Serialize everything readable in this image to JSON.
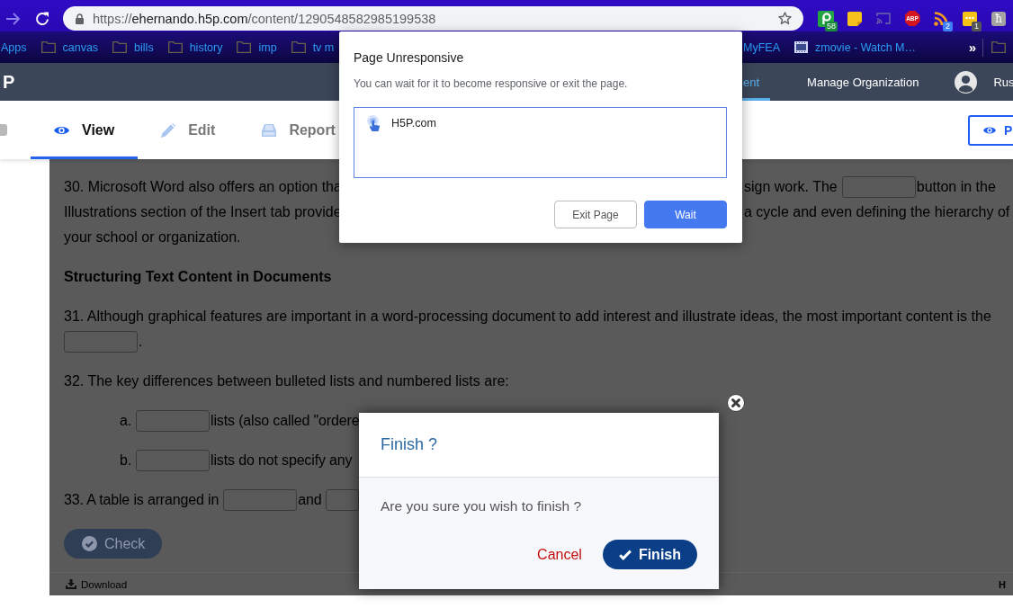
{
  "browser": {
    "nav_buttons": [
      {
        "kind": "forward",
        "disabled": true
      },
      {
        "kind": "reload",
        "disabled": false
      }
    ],
    "address": {
      "scheme": "https://",
      "host": "ehernando.h5p.com",
      "path": "/content/1290548582985199538"
    },
    "extensions": [
      {
        "kind": "pin",
        "badge": "58"
      },
      {
        "kind": "note"
      },
      {
        "kind": "cast"
      },
      {
        "kind": "adblock",
        "label": "ABP"
      },
      {
        "kind": "rss",
        "badge": "2"
      },
      {
        "kind": "chat",
        "badge": "1"
      },
      {
        "kind": "letter",
        "label": "ħ"
      }
    ]
  },
  "bookmarks": {
    "left": [
      {
        "kind": "text",
        "label": "Apps"
      },
      {
        "kind": "folder",
        "label": "canvas"
      },
      {
        "kind": "folder",
        "label": "bills"
      },
      {
        "kind": "folder",
        "label": "history"
      },
      {
        "kind": "folder",
        "label": "imp"
      },
      {
        "kind": "folder",
        "label": "tv m"
      }
    ],
    "right": [
      {
        "kind": "text",
        "label": "MyFEA"
      },
      {
        "kind": "film",
        "label": "zmovie - Watch M…"
      },
      {
        "kind": "more",
        "label": "»"
      },
      {
        "kind": "folder"
      }
    ]
  },
  "nav": {
    "logo": "P",
    "items": [
      {
        "label": "ent",
        "selected": true
      },
      {
        "label": "Manage Organization",
        "selected": false
      }
    ],
    "user": "Rus"
  },
  "tabs": [
    {
      "kind": "view",
      "label": "View",
      "selected": true
    },
    {
      "kind": "edit",
      "label": "Edit",
      "selected": false
    },
    {
      "kind": "report",
      "label": "Report",
      "selected": false
    }
  ],
  "preview_button": {
    "label": "P"
  },
  "content": {
    "blocks": [
      {
        "kind": "paragraph",
        "lines": [
          {
            "kind": "split",
            "parts": [
              {
                "kind": "text",
                "text": "30. Microsoft Word also offers an option tha"
              }
            ],
            "right": [
              {
                "kind": "text",
                "text": "sign work. The"
              },
              {
                "kind": "blank"
              },
              {
                "kind": "text",
                "text": "button in the"
              }
            ]
          },
          {
            "kind": "split",
            "parts": [
              {
                "kind": "text",
                "text": "Illustrations section of the Insert tab provide"
              }
            ],
            "right": [
              {
                "kind": "text",
                "text": "a cycle and even defining the hierarchy of"
              }
            ]
          },
          {
            "kind": "full",
            "parts": [
              {
                "kind": "text",
                "text": "your school or organization."
              }
            ]
          }
        ]
      },
      {
        "kind": "heading",
        "text": "Structuring Text Content in Documents"
      },
      {
        "kind": "paragraph",
        "lines": [
          {
            "kind": "full",
            "parts": [
              {
                "kind": "text",
                "text": "31. Although graphical features are important in a word-processing document to add interest and illustrate ideas, the most important content is the"
              }
            ]
          },
          {
            "kind": "full",
            "parts": [
              {
                "kind": "blank"
              },
              {
                "kind": "text",
                "text": "."
              }
            ]
          }
        ]
      },
      {
        "kind": "paragraph",
        "lines": [
          {
            "kind": "full",
            "parts": [
              {
                "kind": "text",
                "text": "32. The key differences between bulleted lists and numbered lists are:"
              }
            ]
          }
        ]
      },
      {
        "kind": "paragraph",
        "lines": [
          {
            "kind": "cut",
            "marker": "a.",
            "parts": [
              {
                "kind": "blank"
              },
              {
                "kind": "text",
                "text": "lists (also called \"ordere"
              }
            ]
          }
        ]
      },
      {
        "kind": "paragraph",
        "lines": [
          {
            "kind": "cut",
            "marker": "b.",
            "parts": [
              {
                "kind": "blank"
              },
              {
                "kind": "text",
                "text": "lists do not specify any"
              }
            ]
          }
        ]
      },
      {
        "kind": "paragraph",
        "lines": [
          {
            "kind": "cut",
            "parts": [
              {
                "kind": "text",
                "text": "33. A table is arranged in"
              },
              {
                "kind": "blank"
              },
              {
                "kind": "text",
                "text": "and"
              },
              {
                "kind": "blank"
              }
            ]
          }
        ]
      }
    ],
    "check_button": "Check",
    "footer": {
      "download": "Download",
      "logo": "H"
    }
  },
  "unresponsive_dialog": {
    "title": "Page Unresponsive",
    "message": "You can wait for it to become responsive or exit the page.",
    "pages": [
      {
        "label": "H5P.com"
      }
    ],
    "buttons": [
      {
        "kind": "secondary",
        "label": "Exit Page"
      },
      {
        "kind": "primary",
        "label": "Wait"
      }
    ]
  },
  "finish_dialog": {
    "title": "Finish ?",
    "message": "Are you sure you wish to finish ?",
    "buttons": [
      {
        "kind": "link",
        "label": "Cancel"
      },
      {
        "kind": "primary",
        "label": "Finish"
      }
    ]
  }
}
